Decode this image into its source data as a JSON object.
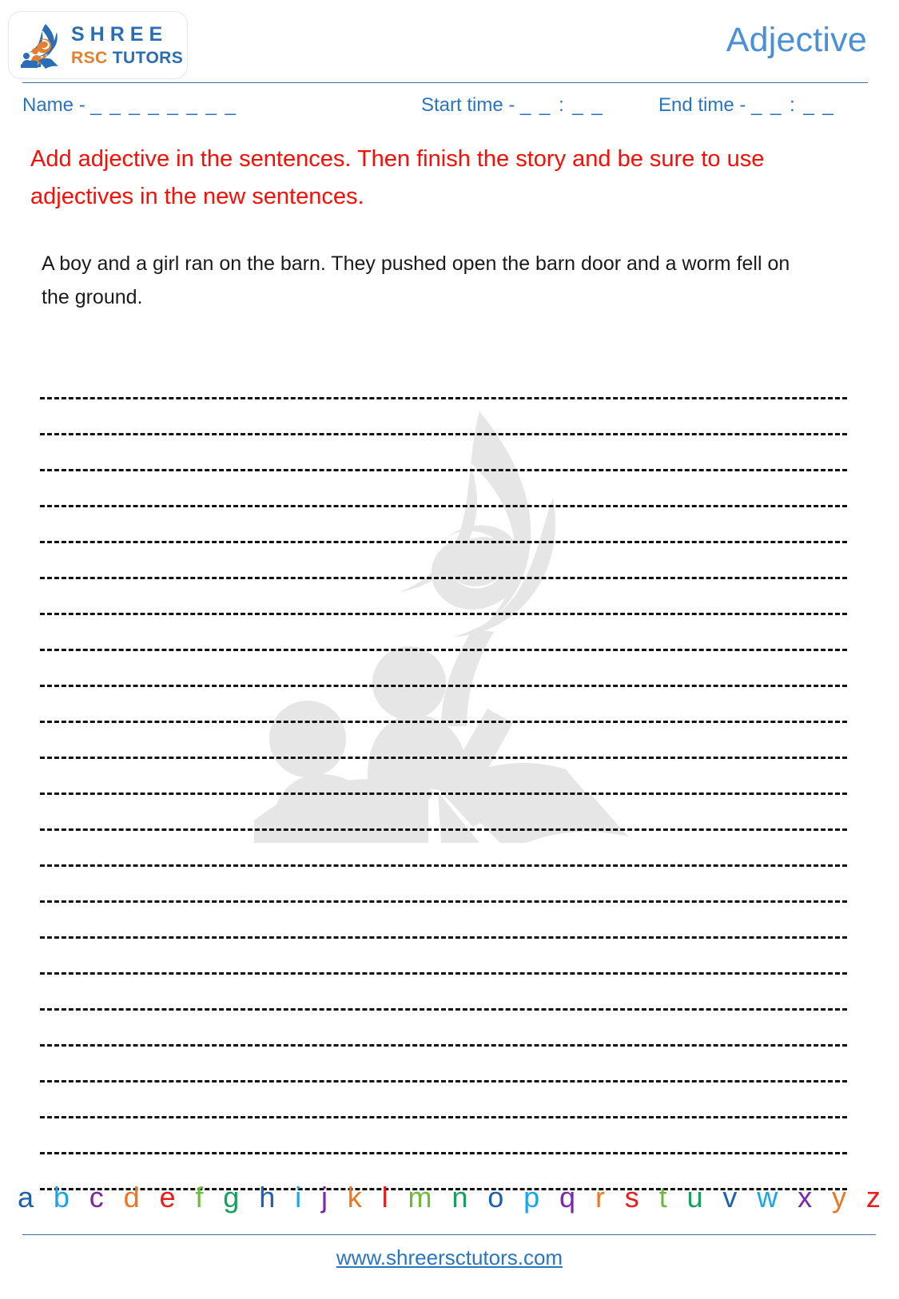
{
  "header": {
    "logo": {
      "mark_icon": "flame-book-logo-icon",
      "brand_primary": "SHREE",
      "brand_secondary_orange": "RSC",
      "brand_secondary_blue": "TUTORS"
    },
    "title": "Adjective"
  },
  "meta": {
    "name_label": "Name -",
    "name_blank": "_ _ _ _ _ _ _ _",
    "start_time_label": "Start time -",
    "start_time_blank": "_ _ : _ _",
    "end_time_label": "End time -",
    "end_time_blank": "_ _ : _ _"
  },
  "instruction": {
    "text": "Add adjective in the sentences. Then finish the story and be sure to use adjectives in the new sentences."
  },
  "story": {
    "text": "A boy and a girl ran on the barn. They pushed open the barn door and a worm fell on the ground."
  },
  "writing_area": {
    "line_count": 23
  },
  "alphabet": {
    "letters": [
      {
        "char": "a",
        "color": "#1f5fae"
      },
      {
        "char": "b",
        "color": "#1ba4ee"
      },
      {
        "char": "c",
        "color": "#7b28a8"
      },
      {
        "char": "d",
        "color": "#ef7620"
      },
      {
        "char": "e",
        "color": "#ee1b1b"
      },
      {
        "char": "f",
        "color": "#6cbb3c"
      },
      {
        "char": "g",
        "color": "#16a05c"
      },
      {
        "char": "h",
        "color": "#1f5fae"
      },
      {
        "char": "i",
        "color": "#1ba4ee"
      },
      {
        "char": "j",
        "color": "#7b28a8"
      },
      {
        "char": "k",
        "color": "#ef7620"
      },
      {
        "char": "l",
        "color": "#ee1b1b"
      },
      {
        "char": "m",
        "color": "#6cbb3c"
      },
      {
        "char": "n",
        "color": "#16a05c"
      },
      {
        "char": "o",
        "color": "#1f5fae"
      },
      {
        "char": "p",
        "color": "#1ba4ee"
      },
      {
        "char": "q",
        "color": "#7b28a8"
      },
      {
        "char": "r",
        "color": "#ef7620"
      },
      {
        "char": "s",
        "color": "#ee1b1b"
      },
      {
        "char": "t",
        "color": "#6cbb3c"
      },
      {
        "char": "u",
        "color": "#16a05c"
      },
      {
        "char": "v",
        "color": "#1f5fae"
      },
      {
        "char": "w",
        "color": "#1ba4ee"
      },
      {
        "char": "x",
        "color": "#7b28a8"
      },
      {
        "char": "y",
        "color": "#ef7620"
      },
      {
        "char": "z",
        "color": "#ee1b1b"
      }
    ]
  },
  "footer": {
    "website": "www.shreersctutors.com"
  },
  "colors": {
    "brand_blue": "#2a6db5",
    "brand_orange": "#e2802f",
    "title_blue": "#4a90d9",
    "instruction_red": "#fb0d06",
    "rule_blue": "#3b6fa8",
    "watermark_gray": "#e6e6e6"
  }
}
